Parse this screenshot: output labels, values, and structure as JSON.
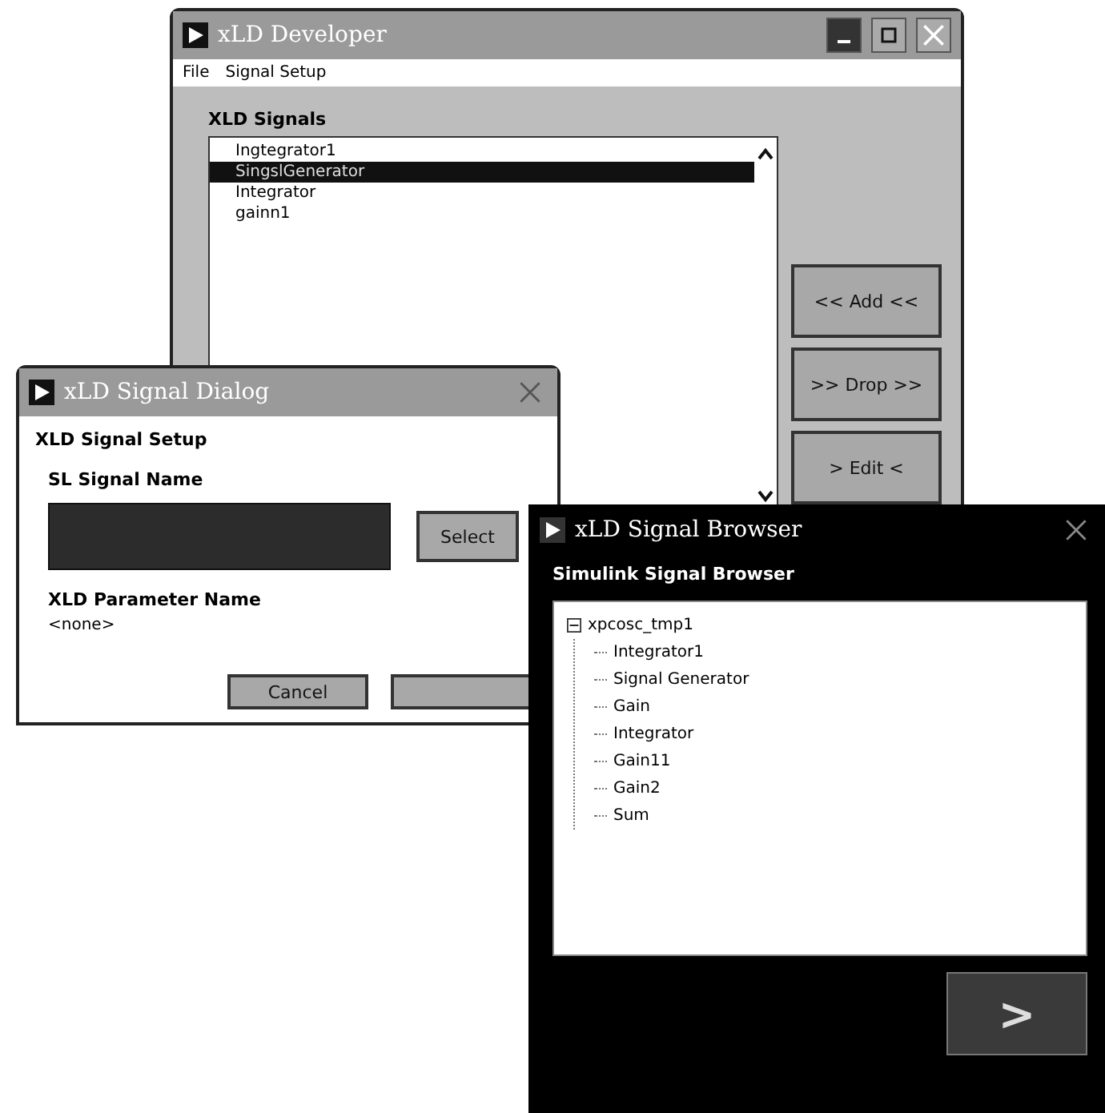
{
  "developer_window": {
    "title": "xLD Developer",
    "menu": [
      "File",
      "Signal Setup"
    ],
    "list_label": "XLD Signals",
    "signals": [
      {
        "label": "Ingtegrator1",
        "selected": false
      },
      {
        "label": "SingslGenerator",
        "selected": true
      },
      {
        "label": "Integrator",
        "selected": false
      },
      {
        "label": "gainn1",
        "selected": false
      }
    ],
    "buttons": [
      "<< Add <<",
      ">> Drop >>",
      "> Edit <"
    ]
  },
  "dialog_window": {
    "title": "xLD Signal Dialog",
    "heading": "XLD Signal Setup",
    "signal_label": "SL Signal Name",
    "select_button": "Select",
    "parameter_label": "XLD Parameter Name",
    "parameter_value": "<none>",
    "cancel_button": "Cancel"
  },
  "browser_window": {
    "title": "xLD Signal Browser",
    "heading": "Simulink Signal Browser",
    "tree": [
      {
        "label": "xpcosc_tmp1",
        "expanded": true,
        "children": [
          {
            "label": "Integrator1"
          },
          {
            "label": "Signal Generator"
          },
          {
            "label": "Gain"
          },
          {
            "label": "Integrator"
          },
          {
            "label": "Gain11"
          },
          {
            "label": "Gain2"
          },
          {
            "label": "Sum"
          }
        ]
      }
    ],
    "next_button": ">"
  }
}
